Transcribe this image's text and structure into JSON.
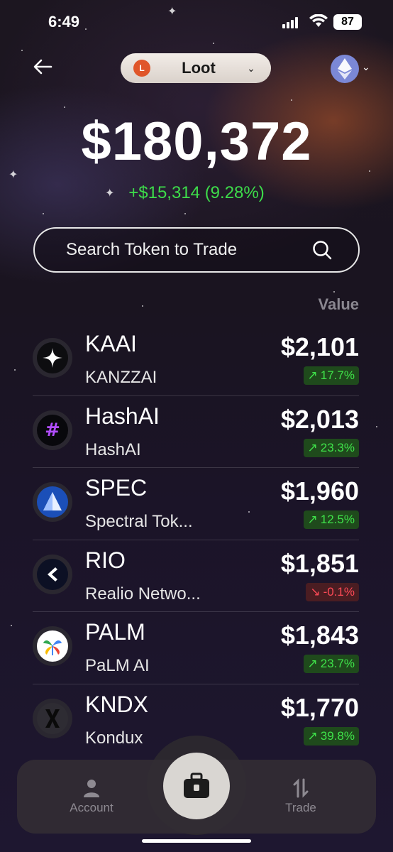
{
  "status_bar": {
    "time": "6:49",
    "battery": "87"
  },
  "header": {
    "wallet_initial": "L",
    "wallet_name": "Loot",
    "network": "ethereum-icon"
  },
  "portfolio": {
    "balance": "$180,372",
    "change": "+$15,314 (9.28%)"
  },
  "search": {
    "placeholder": "Search Token to Trade"
  },
  "list": {
    "value_header": "Value",
    "tokens": [
      {
        "symbol": "KAAI",
        "name": "KANZZAI",
        "value": "$2,101",
        "change": "17.7%",
        "direction": "up"
      },
      {
        "symbol": "HashAI",
        "name": "HashAI",
        "value": "$2,013",
        "change": "23.3%",
        "direction": "up"
      },
      {
        "symbol": "SPEC",
        "name": "Spectral Tok...",
        "value": "$1,960",
        "change": "12.5%",
        "direction": "up"
      },
      {
        "symbol": "RIO",
        "name": "Realio Netwo...",
        "value": "$1,851",
        "change": "-0.1%",
        "direction": "down"
      },
      {
        "symbol": "PALM",
        "name": "PaLM AI",
        "value": "$1,843",
        "change": "23.7%",
        "direction": "up"
      },
      {
        "symbol": "KNDX",
        "name": "Kondux",
        "value": "$1,770",
        "change": "39.8%",
        "direction": "up"
      }
    ]
  },
  "nav": {
    "account_label": "Account",
    "trade_label": "Trade"
  },
  "colors": {
    "positive": "#3fe24a",
    "negative": "#ff4a57",
    "accent_wallet": "#e0562a",
    "eth": "#7b88d6"
  }
}
